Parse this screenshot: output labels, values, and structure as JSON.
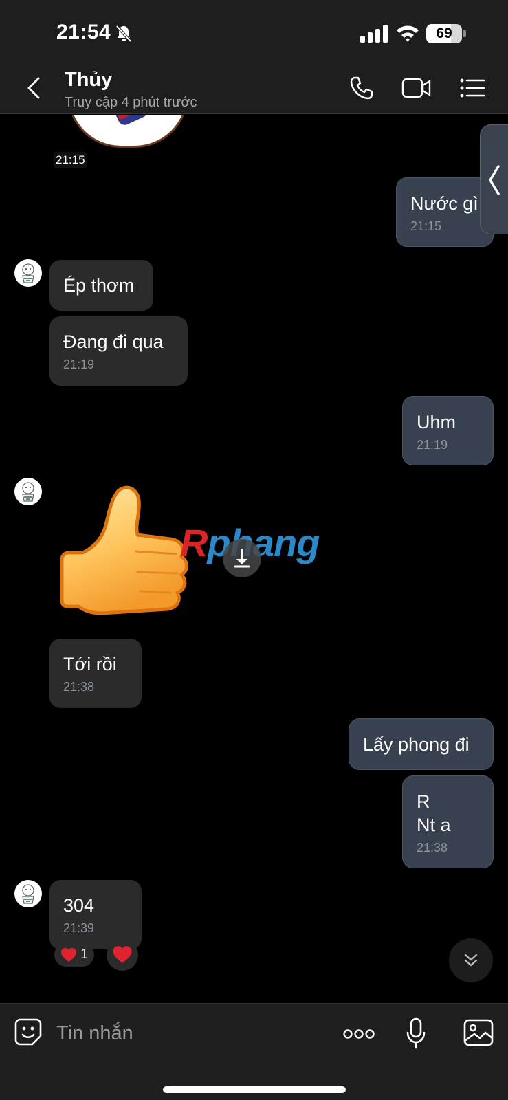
{
  "status_bar": {
    "time": "21:54",
    "battery": "69",
    "battery_level": 0.69,
    "icons": [
      "bell-slash-icon",
      "signal-icon",
      "wifi-icon",
      "battery-icon"
    ]
  },
  "header": {
    "name": "Thủy",
    "status": "Truy cập 4 phút trước",
    "icons": [
      "back-chevron-icon",
      "phone-icon",
      "video-camera-icon",
      "list-menu-icon"
    ]
  },
  "messages": [
    {
      "direction": "in",
      "kind": "sticker",
      "time": "21:15"
    },
    {
      "direction": "out",
      "text": "Nước gì",
      "time": "21:15"
    },
    {
      "direction": "in",
      "text": "Ép thơm"
    },
    {
      "direction": "in",
      "text": "Đang đi qua",
      "time": "21:19"
    },
    {
      "direction": "out",
      "text": "Uhm",
      "time": "21:19"
    },
    {
      "direction": "in",
      "kind": "sticker",
      "sticker": "thumbs-up"
    },
    {
      "direction": "in",
      "text": "Tới rồi",
      "time": "21:38"
    },
    {
      "direction": "out",
      "text": "Lấy phong đi"
    },
    {
      "direction": "out",
      "text": "R\nNt a",
      "time": "21:38"
    },
    {
      "direction": "in",
      "text": "304",
      "time": "21:39",
      "reaction": {
        "emoji": "heart",
        "count": "1"
      }
    }
  ],
  "watermark": {
    "part1": "R",
    "part2": "phang",
    "colors": {
      "part1": "#d8262b",
      "part2": "#2c88c8"
    }
  },
  "input": {
    "placeholder": "Tin nhắn",
    "icons": [
      "sticker-icon",
      "more-options-icon",
      "microphone-icon",
      "image-icon"
    ]
  },
  "colors": {
    "background": "#000000",
    "bar": "#1e1e1e",
    "incoming_bubble": "#2b2b2b",
    "outgoing_bubble": "#37414f",
    "heart": "#e0242f"
  }
}
